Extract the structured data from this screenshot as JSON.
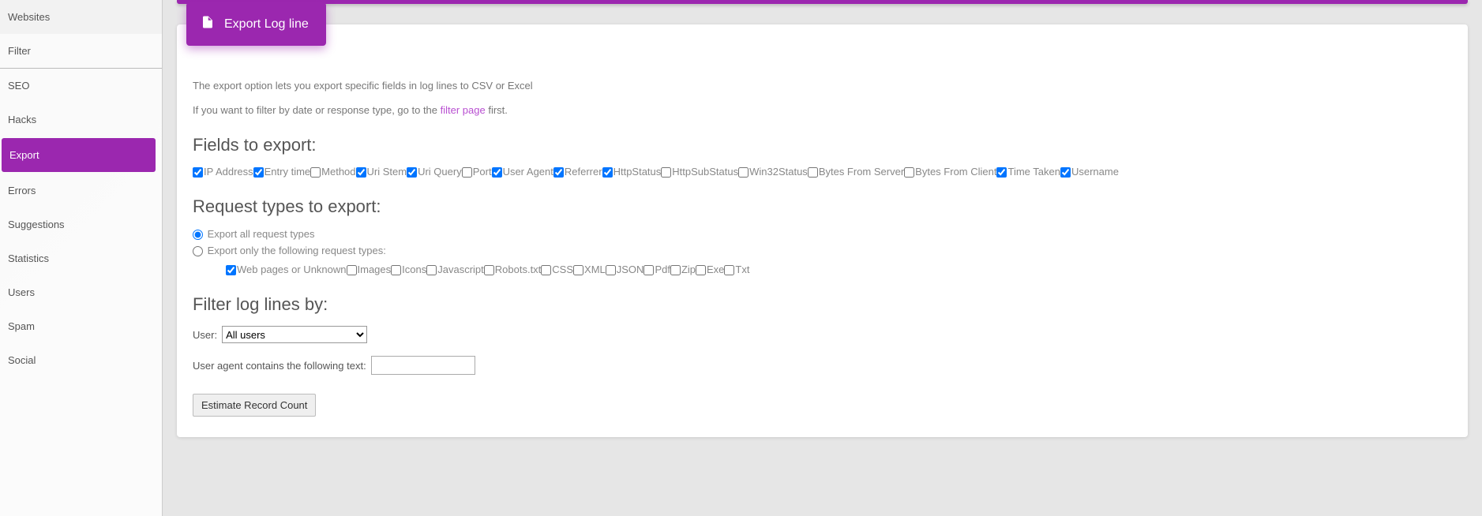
{
  "sidebar": {
    "items": [
      {
        "label": "Websites",
        "active": false
      },
      {
        "label": "Filter",
        "active": false,
        "sep": true
      },
      {
        "label": "SEO",
        "active": false
      },
      {
        "label": "Hacks",
        "active": false
      },
      {
        "label": "Export",
        "active": true
      },
      {
        "label": "Errors",
        "active": false
      },
      {
        "label": "Suggestions",
        "active": false
      },
      {
        "label": "Statistics",
        "active": false
      },
      {
        "label": "Users",
        "active": false
      },
      {
        "label": "Spam",
        "active": false
      },
      {
        "label": "Social",
        "active": false
      }
    ]
  },
  "header": {
    "title": "Export Log line"
  },
  "intro": {
    "line1": "The export option lets you export specific fields in log lines to CSV or Excel",
    "line2a": "If you want to filter by date or response type, go to the ",
    "line2Link": "filter page",
    "line2b": " first."
  },
  "sections": {
    "fields": "Fields to export:",
    "reqtypes": "Request types to export:",
    "filter": "Filter log lines by:"
  },
  "fields": [
    {
      "label": "IP Address",
      "checked": true
    },
    {
      "label": "Entry time",
      "checked": true
    },
    {
      "label": "Method",
      "checked": false
    },
    {
      "label": "Uri Stem",
      "checked": true
    },
    {
      "label": "Uri Query",
      "checked": true
    },
    {
      "label": "Port",
      "checked": false
    },
    {
      "label": "User Agent",
      "checked": true
    },
    {
      "label": "Referrer",
      "checked": true
    },
    {
      "label": "HttpStatus",
      "checked": true
    },
    {
      "label": "HttpSubStatus",
      "checked": false
    },
    {
      "label": "Win32Status",
      "checked": false
    },
    {
      "label": "Bytes From Server",
      "checked": false
    },
    {
      "label": "Bytes From Client",
      "checked": false
    },
    {
      "label": "Time Taken",
      "checked": true
    },
    {
      "label": "Username",
      "checked": true
    }
  ],
  "reqRadio": {
    "all": "Export all request types",
    "only": "Export only the following request types:",
    "selected": "all"
  },
  "reqTypeChecks": [
    {
      "label": "Web pages or Unknown",
      "checked": true
    },
    {
      "label": "Images",
      "checked": false
    },
    {
      "label": "Icons",
      "checked": false
    },
    {
      "label": "Javascript",
      "checked": false
    },
    {
      "label": "Robots.txt",
      "checked": false
    },
    {
      "label": "CSS",
      "checked": false
    },
    {
      "label": "XML",
      "checked": false
    },
    {
      "label": "JSON",
      "checked": false
    },
    {
      "label": "Pdf",
      "checked": false
    },
    {
      "label": "Zip",
      "checked": false
    },
    {
      "label": "Exe",
      "checked": false
    },
    {
      "label": "Txt",
      "checked": false
    }
  ],
  "filter": {
    "userLabel": "User:",
    "userSelected": "All users",
    "uaLabel": "User agent contains the following text:",
    "uaValue": ""
  },
  "buttons": {
    "estimate": "Estimate Record Count"
  }
}
